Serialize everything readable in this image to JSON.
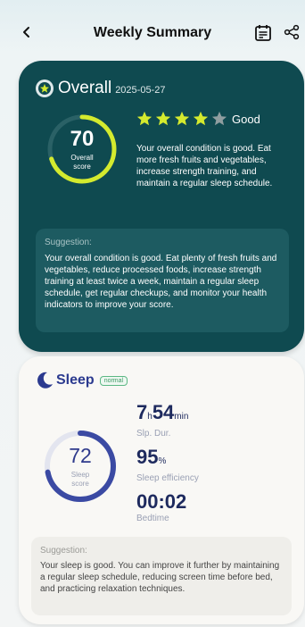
{
  "header": {
    "title": "Weekly Summary",
    "icons": [
      "chevron-left-icon",
      "calendar-icon",
      "share-icon"
    ]
  },
  "overall": {
    "title": "Overall",
    "date": "2025-05-27",
    "score": "70",
    "score_label_line1": "Overall",
    "score_label_line2": "score",
    "score_fraction": 0.7,
    "rating_stars_filled": 4,
    "rating_stars_total": 5,
    "rating_label": "Good",
    "description": "Your overall condition is good. Eat more fresh fruits and vegetables, increase strength training, and maintain a regular sleep schedule.",
    "suggestion_label": "Suggestion:",
    "suggestion_text": "Your overall condition is good. Eat plenty of fresh fruits and vegetables, reduce processed foods, increase strength training at least twice a week, maintain a regular sleep schedule, get regular checkups, and monitor your health indicators to improve your score."
  },
  "sleep": {
    "title": "Sleep",
    "badge": "normal",
    "score": "72",
    "score_label_line1": "Sleep",
    "score_label_line2": "score",
    "score_fraction": 0.72,
    "duration_hours": "7",
    "duration_hours_unit": "h",
    "duration_minutes": "54",
    "duration_minutes_unit": "min",
    "duration_label": "Slp. Dur.",
    "efficiency_value": "95",
    "efficiency_unit": "%",
    "efficiency_label": "Sleep efficiency",
    "bedtime_value": "00:02",
    "bedtime_label": "Bedtime",
    "suggestion_label": "Suggestion:",
    "suggestion_text": "Your sleep is good. You can improve it further by maintaining a regular sleep schedule, reducing screen time before bed, and practicing relaxation techniques."
  },
  "colors": {
    "overall_card": "#0f4a50",
    "overall_ring": "#d4ea2e",
    "star_filled": "#d4ea2e",
    "star_empty": "#8f9ea0",
    "sleep_ring": "#3b4aa3",
    "sleep_ring_track": "#e3e5ef"
  }
}
